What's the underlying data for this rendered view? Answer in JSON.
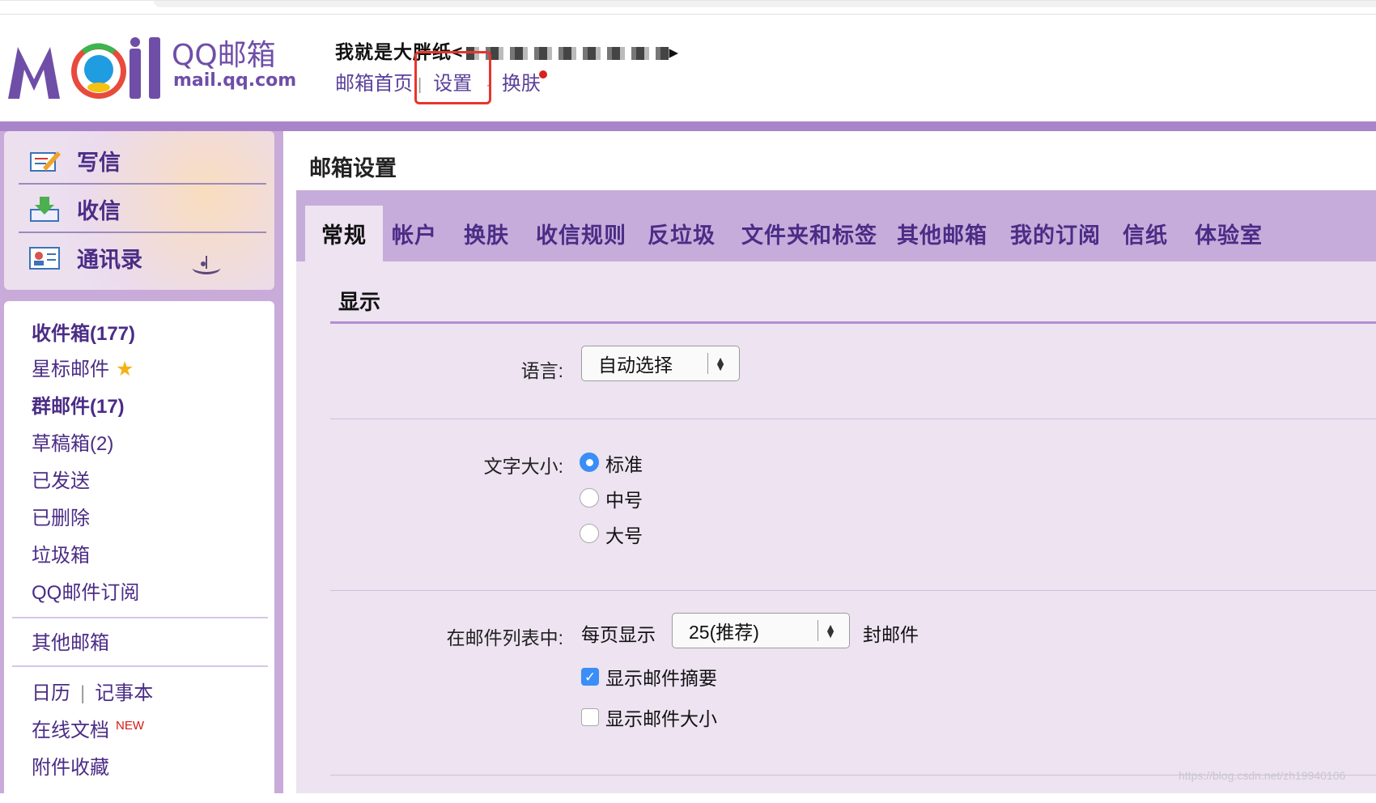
{
  "header": {
    "brand_name": "QQ邮箱",
    "brand_domain": "mail.qq.com",
    "user_text": "我就是大胖纸<",
    "links": {
      "home": "邮箱首页",
      "settings": "设置",
      "skin": "换肤"
    },
    "separator": "|"
  },
  "sidebar": {
    "actions": [
      {
        "label": "写信",
        "icon": "compose-icon"
      },
      {
        "label": "收信",
        "icon": "inbox-download-icon"
      },
      {
        "label": "通讯录",
        "icon": "contacts-icon"
      }
    ],
    "folders": {
      "inbox": "收件箱(177)",
      "starred": "星标邮件",
      "group": "群邮件(17)",
      "drafts": "草稿箱(2)",
      "sent": "已发送",
      "deleted": "已删除",
      "spam": "垃圾箱",
      "subscriptions": "QQ邮件订阅",
      "other_mailboxes": "其他邮箱",
      "calendar": "日历",
      "tools_separator": "|",
      "notebook": "记事本",
      "online_docs": "在线文档",
      "new_tag": "NEW",
      "attachments": "附件收藏"
    }
  },
  "settings": {
    "title": "邮箱设置",
    "tabs": [
      "常规",
      "帐户",
      "换肤",
      "收信规则",
      "反垃圾",
      "文件夹和标签",
      "其他邮箱",
      "我的订阅",
      "信纸",
      "体验室"
    ],
    "active_tab": "常规",
    "section_title": "显示",
    "language": {
      "label": "语言:",
      "value": "自动选择"
    },
    "font_size": {
      "label": "文字大小:",
      "options": [
        "标准",
        "中号",
        "大号"
      ],
      "selected": "标准"
    },
    "mail_list": {
      "label": "在邮件列表中:",
      "per_page_label": "每页显示",
      "per_page_value": "25(推荐)",
      "per_page_suffix": "封邮件",
      "show_summary": {
        "label": "显示邮件摘要",
        "checked": true
      },
      "show_size": {
        "label": "显示邮件大小",
        "checked": false
      }
    }
  },
  "watermark": "https://blog.csdn.net/zh19940106",
  "colors": {
    "accent_purple": "#a984c9",
    "tab_bar": "#c6acda",
    "link_purple": "#4b2c86",
    "highlight_red": "#e8352c",
    "radio_blue": "#3a8ef6"
  }
}
